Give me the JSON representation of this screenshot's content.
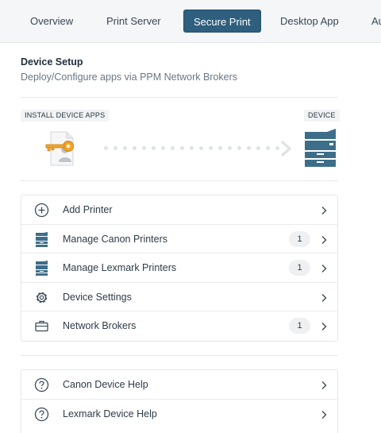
{
  "nav": {
    "tabs": [
      {
        "label": "Overview",
        "active": false
      },
      {
        "label": "Print Server",
        "active": false
      },
      {
        "label": "Secure Print",
        "active": true
      },
      {
        "label": "Desktop App",
        "active": false
      },
      {
        "label": "Au",
        "active": false
      }
    ]
  },
  "setup": {
    "title": "Device Setup",
    "subtitle": "Deploy/Configure apps via PPM Network Brokers",
    "install_label": "INSTALL DEVICE APPS",
    "device_label": "DEVICE"
  },
  "menu": {
    "items": [
      {
        "label": "Add Printer",
        "icon": "plus-circle-icon"
      },
      {
        "label": "Manage Canon Printers",
        "icon": "printer-icon",
        "count": "1"
      },
      {
        "label": "Manage Lexmark Printers",
        "icon": "printer-icon",
        "count": "1"
      },
      {
        "label": "Device Settings",
        "icon": "gear-icon"
      },
      {
        "label": "Network Brokers",
        "icon": "briefcase-icon",
        "count": "1"
      }
    ]
  },
  "help": {
    "items": [
      {
        "label": "Canon Device Help",
        "icon": "help-circle-icon"
      },
      {
        "label": "Lexmark Device Help",
        "icon": "help-circle-icon"
      }
    ]
  },
  "colors": {
    "active_tab": "#2f5f7e",
    "accent_teal": "#3d6e89",
    "key_gold": "#f0a52a"
  }
}
